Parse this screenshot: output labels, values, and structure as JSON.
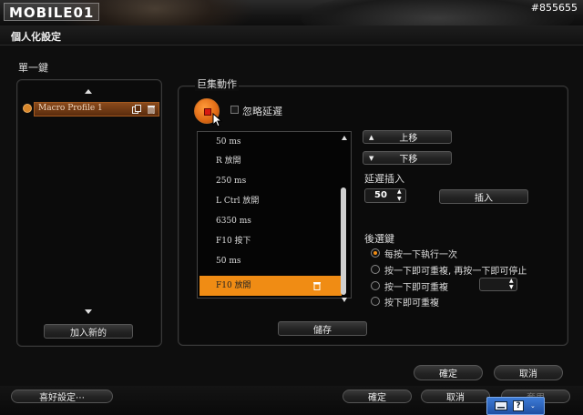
{
  "banner": {
    "logo_text": "MOBILE01",
    "watermark": "#855655"
  },
  "window": {
    "title": "個人化設定"
  },
  "left": {
    "section_label": "單一鍵",
    "profile_name": "Macro Profile 1",
    "add_new_label": "加入新的"
  },
  "macro": {
    "section_label": "巨集動作",
    "ignore_delay_label": "忽略延遲",
    "rows": [
      {
        "text": "50 ms"
      },
      {
        "text": "R 放開"
      },
      {
        "text": "250 ms"
      },
      {
        "text": "L Ctrl 放開"
      },
      {
        "text": "6350 ms"
      },
      {
        "text": "F10 按下"
      },
      {
        "text": "50 ms"
      },
      {
        "text": "F10 放開"
      }
    ],
    "save_label": "儲存"
  },
  "controls": {
    "move_up_label": "上移",
    "move_down_label": "下移",
    "insert_delay_label": "延遲插入",
    "delay_value": "50",
    "insert_label": "插入",
    "after_key_label": "後選鍵",
    "options": [
      "每按一下執行一次",
      "按一下即可重複, 再按一下即可停止",
      "按一下即可重複",
      "按下即可重複"
    ],
    "selected_option": 0
  },
  "dialog": {
    "ok_label": "確定",
    "cancel_label": "取消"
  },
  "footer": {
    "prefs_label": "喜好設定⋯",
    "ok_label": "確定",
    "cancel_label": "取消",
    "apply_label": "套用"
  },
  "colors": {
    "accent": "#f08c14",
    "record": "#e0391a"
  }
}
